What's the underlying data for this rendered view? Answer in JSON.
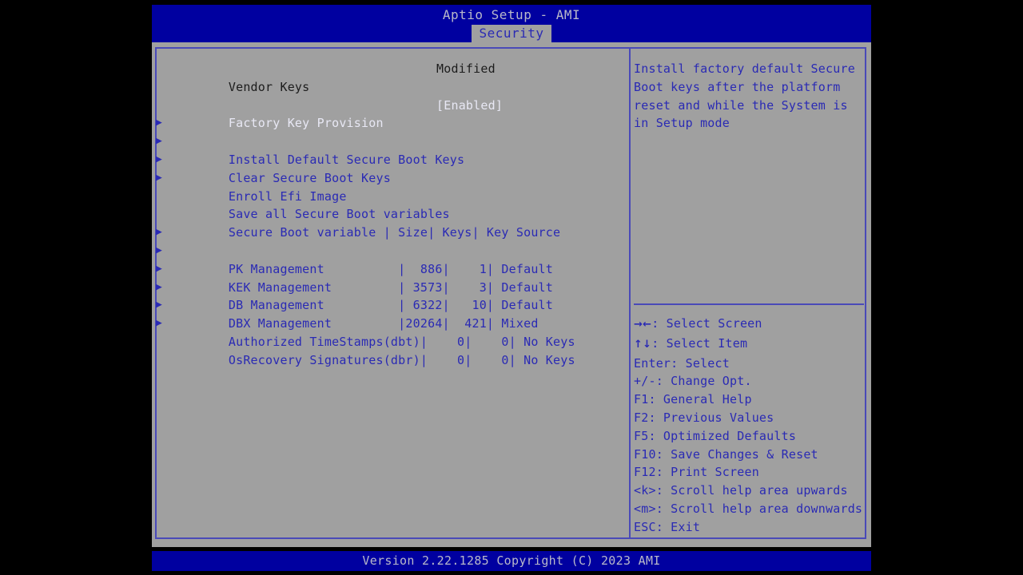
{
  "header": {
    "title": "Aptio Setup - AMI",
    "tabs": [
      {
        "label": "Security",
        "active": true
      }
    ]
  },
  "colors": {
    "band_blue": "#0000a0",
    "body_gray": "#a0a0a0",
    "accent_blue": "#2a2ab4",
    "border_blue": "#4a4ab8",
    "title_text": "#b9b9c9",
    "light_text": "#e8e8f4",
    "dim_text": "#1c1c1c",
    "letterbox": "#000000"
  },
  "main": {
    "status_row": {
      "label": "Vendor Keys",
      "value": "Modified"
    },
    "option_row": {
      "label": "Factory Key Provision",
      "value": "[Enabled]"
    },
    "actions": [
      {
        "label": "Install Default Secure Boot Keys",
        "bullet": "submenu-arrow-icon"
      },
      {
        "label": "Clear Secure Boot Keys",
        "bullet": "submenu-arrow-icon"
      },
      {
        "label": "Enroll Efi Image",
        "bullet": "submenu-arrow-icon"
      },
      {
        "label": "Save all Secure Boot variables",
        "bullet": "submenu-arrow-icon"
      }
    ],
    "table": {
      "header": "Secure Boot variable | Size| Keys| Key Source",
      "columns": [
        "Secure Boot variable",
        "Size",
        "Keys",
        "Key Source"
      ],
      "rows": [
        {
          "line": "PK Management          |  886|    1| Default",
          "name": "PK Management",
          "size": "886",
          "keys": "1",
          "source": "Default"
        },
        {
          "line": "KEK Management         | 3573|    3| Default",
          "name": "KEK Management",
          "size": "3573",
          "keys": "3",
          "source": "Default"
        },
        {
          "line": "DB Management          | 6322|   10| Default",
          "name": "DB Management",
          "size": "6322",
          "keys": "10",
          "source": "Default"
        },
        {
          "line": "DBX Management         |20264|  421| Mixed",
          "name": "DBX Management",
          "size": "20264",
          "keys": "421",
          "source": "Mixed"
        },
        {
          "line": "Authorized TimeStamps(dbt)|    0|    0| No Keys",
          "name": "Authorized TimeStamps(dbt)",
          "size": "0",
          "keys": "0",
          "source": "No Keys"
        },
        {
          "line": "OsRecovery Signatures(dbr)|    0|    0| No Keys",
          "name": "OsRecovery Signatures(dbr)",
          "size": "0",
          "keys": "0",
          "source": "No Keys"
        }
      ]
    }
  },
  "help": {
    "lines": [
      "Install factory default Secure",
      "Boot keys after the platform",
      "reset and while the System is",
      "in Setup mode"
    ]
  },
  "legend": [
    {
      "key": "→←",
      "text": ": Select Screen",
      "glyph": true,
      "name": "arrows-left-right-icon"
    },
    {
      "key": "↑↓",
      "text": ": Select Item",
      "glyph": true,
      "name": "arrows-up-down-icon"
    },
    {
      "key": "Enter",
      "text": ": Select",
      "glyph": false,
      "name": "enter-key"
    },
    {
      "key": "+/-",
      "text": ": Change Opt.",
      "glyph": false,
      "name": "plus-minus-key"
    },
    {
      "key": "F1",
      "text": ": General Help",
      "glyph": false,
      "name": "f1-key"
    },
    {
      "key": "F2",
      "text": ": Previous Values",
      "glyph": false,
      "name": "f2-key"
    },
    {
      "key": "F5",
      "text": ": Optimized Defaults",
      "glyph": false,
      "name": "f5-key"
    },
    {
      "key": "F10",
      "text": ": Save Changes & Reset",
      "glyph": false,
      "name": "f10-key"
    },
    {
      "key": "F12",
      "text": ": Print Screen",
      "glyph": false,
      "name": "f12-key"
    },
    {
      "key": "<k>",
      "text": ": Scroll help area upwards",
      "glyph": false,
      "name": "scroll-up-key"
    },
    {
      "key": "<m>",
      "text": ": Scroll help area downwards",
      "glyph": false,
      "name": "scroll-down-key"
    },
    {
      "key": "ESC",
      "text": ": Exit",
      "glyph": false,
      "name": "esc-key"
    }
  ],
  "footer": {
    "text": "Version 2.22.1285 Copyright (C) 2023 AMI"
  }
}
